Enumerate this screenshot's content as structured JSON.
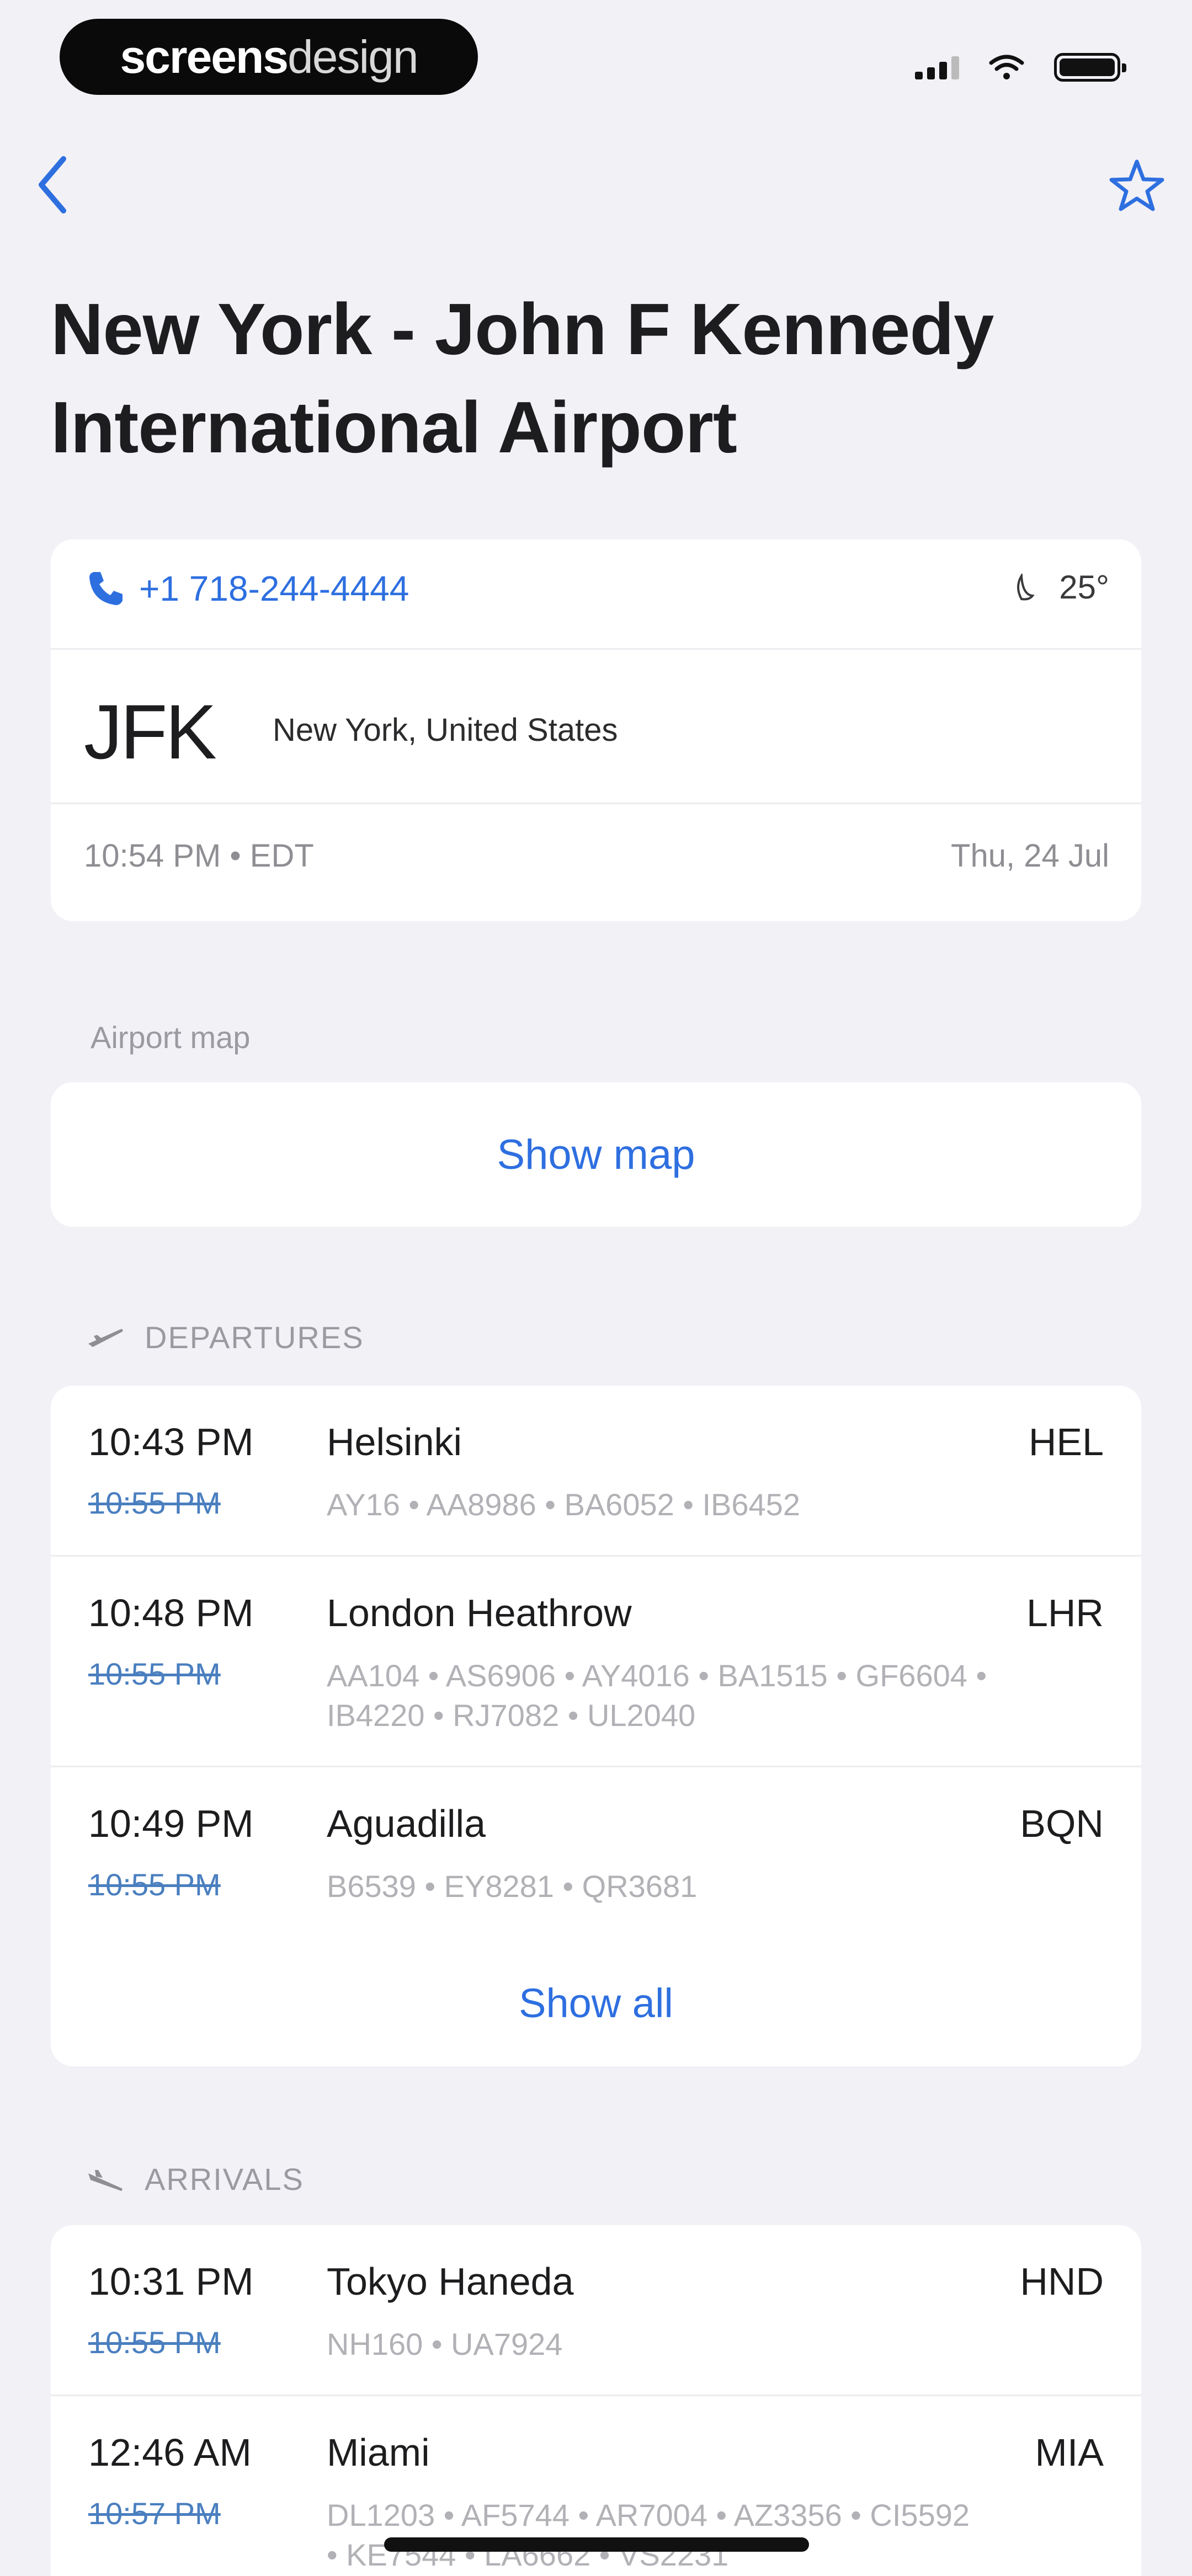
{
  "brand": {
    "bold": "screens",
    "light": "design"
  },
  "nav": {
    "back_icon": "chevron-left-icon",
    "favorite_icon": "star-icon",
    "accent": "#2e6fe0"
  },
  "airport": {
    "name": "New York - John F Kennedy International Airport",
    "phone": "+1 718-244-4444",
    "temperature": "25°",
    "iata": "JFK",
    "location": "New York, United States",
    "local_time": "10:54 PM • EDT",
    "local_date": "Thu, 24 Jul"
  },
  "map": {
    "section_label": "Airport map",
    "button_label": "Show map"
  },
  "departures": {
    "section_label": "DEPARTURES",
    "flights": [
      {
        "time": "10:43 PM",
        "scheduled": "10:55 PM",
        "city": "Helsinki",
        "iata": "HEL",
        "codes": "AY16 • AA8986 • BA6052 • IB6452"
      },
      {
        "time": "10:48 PM",
        "scheduled": "10:55 PM",
        "city": "London Heathrow",
        "iata": "LHR",
        "codes": "AA104 • AS6906 • AY4016 • BA1515 • GF6604 • IB4220 • RJ7082 • UL2040"
      },
      {
        "time": "10:49 PM",
        "scheduled": "10:55 PM",
        "city": "Aguadilla",
        "iata": "BQN",
        "codes": "B6539 • EY8281 • QR3681"
      }
    ],
    "show_all_label": "Show all"
  },
  "arrivals": {
    "section_label": "ARRIVALS",
    "flights": [
      {
        "time": "10:31 PM",
        "scheduled": "10:55 PM",
        "city": "Tokyo Haneda",
        "iata": "HND",
        "codes": "NH160 • UA7924"
      },
      {
        "time": "12:46 AM",
        "scheduled": "10:57 PM",
        "city": "Miami",
        "iata": "MIA",
        "codes": "DL1203 • AF5744 • AR7004 • AZ3356 • CI5592 • KE7544 • LA6662 • VS2231"
      }
    ]
  }
}
